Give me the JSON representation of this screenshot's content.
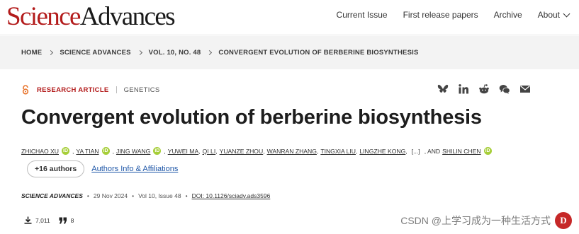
{
  "header": {
    "logo_part1": "Science",
    "logo_part2": "Advances",
    "nav": [
      "Current Issue",
      "First release papers",
      "Archive",
      "About"
    ]
  },
  "breadcrumb": [
    "HOME",
    "SCIENCE ADVANCES",
    "VOL. 10, NO. 48",
    "CONVERGENT EVOLUTION OF BERBERINE BIOSYNTHESIS"
  ],
  "article": {
    "type": "RESEARCH ARTICLE",
    "subject": "GENETICS",
    "title": "Convergent evolution of berberine biosynthesis",
    "authors": [
      "ZHICHAO XU",
      "YA TIAN",
      "JING WANG",
      "YUWEI MA",
      "QI LI",
      "YUANZE ZHOU",
      "WANRAN ZHANG",
      "TINGXIA LIU",
      "LINGZHE KONG"
    ],
    "ellipsis": "[...]",
    "and_text": ", AND",
    "last_author": "SHILIN CHEN",
    "more_authors": "+16 authors",
    "affiliations_link": "Authors Info & Affiliations",
    "journal": "SCIENCE ADVANCES",
    "date": "29 Nov 2024",
    "volume_issue": "Vol 10, Issue 48",
    "doi": "DOI: 10.1126/sciadv.ads3596",
    "downloads": "7,011",
    "citations": "8"
  },
  "share_icons": [
    "bluesky-icon",
    "linkedin-icon",
    "reddit-icon",
    "wechat-icon",
    "email-icon"
  ],
  "colors": {
    "brand_red": "#b31b1b",
    "orcid_green": "#a6ce39",
    "link_blue": "#1f57a8"
  },
  "watermark": {
    "text": "CSDN @上学习成为一种生活方式"
  }
}
